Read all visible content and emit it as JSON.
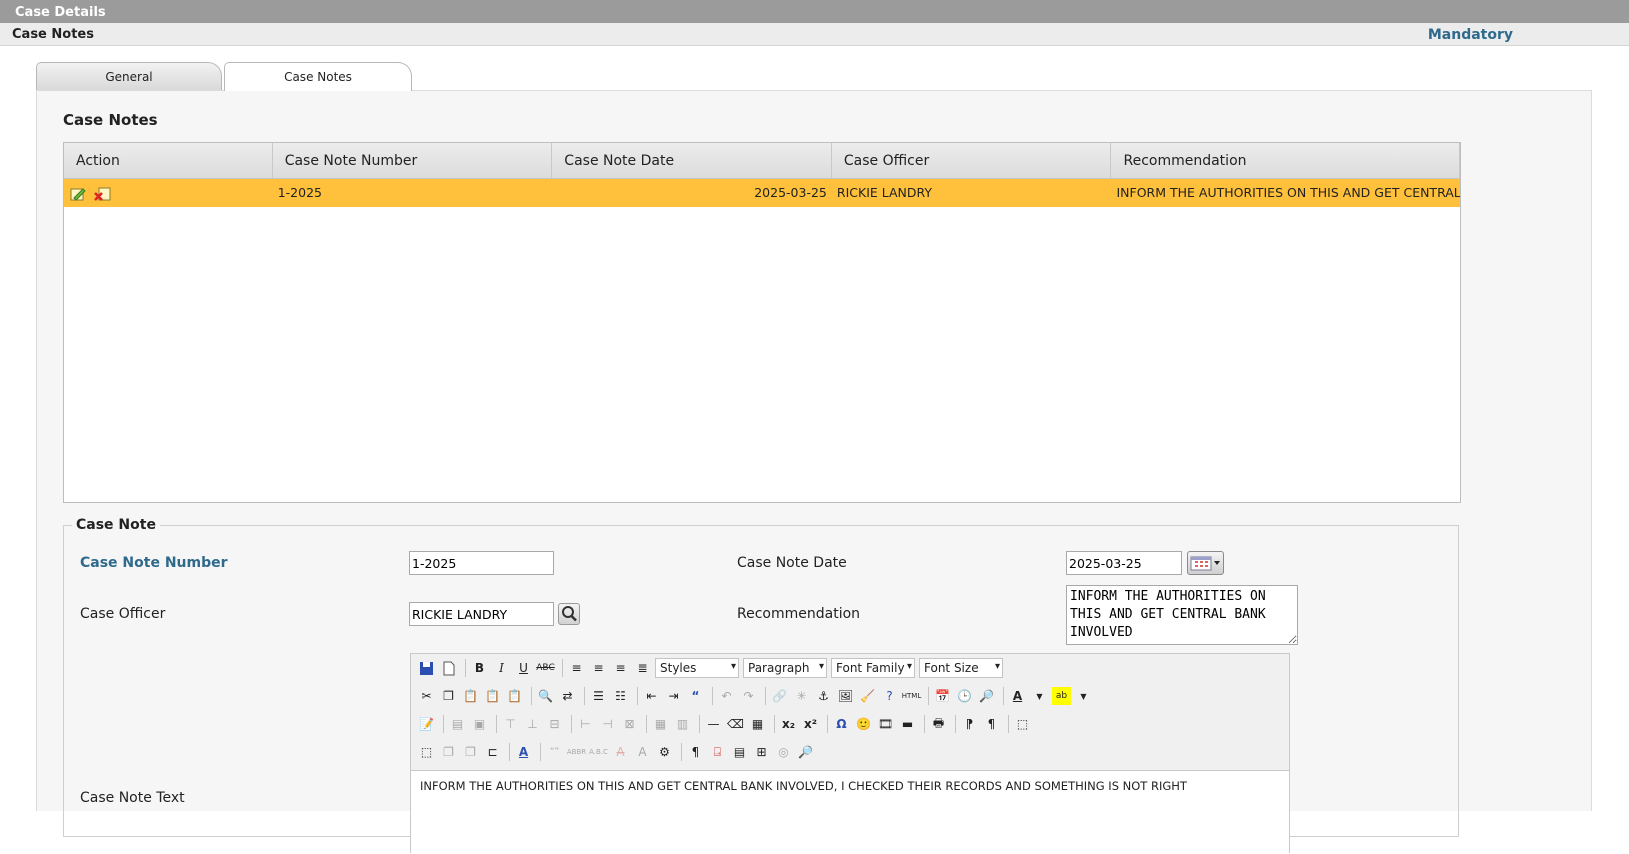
{
  "header": {
    "title": "Case Details",
    "subtitle": "Case Notes",
    "mandatory_label": "Mandatory"
  },
  "tabs": [
    {
      "label": "General",
      "active": false
    },
    {
      "label": "Case Notes",
      "active": true
    }
  ],
  "grid": {
    "title": "Case Notes",
    "columns": [
      "Action",
      "Case Note Number",
      "Case Note Date",
      "Case Officer",
      "Recommendation"
    ],
    "rows": [
      {
        "number": "1-2025",
        "date": "2025-03-25",
        "officer": "RICKIE LANDRY",
        "recommendation": "INFORM THE AUTHORITIES ON THIS AND GET CENTRAL BANK INVOLVED"
      }
    ],
    "selected_row_color": "#ffc13b"
  },
  "form": {
    "legend": "Case Note",
    "number_label": "Case Note Number",
    "number_value": "1-2025",
    "date_label": "Case Note Date",
    "date_value": "2025-03-25",
    "officer_label": "Case Officer",
    "officer_value": "RICKIE LANDRY",
    "recommendation_label": "Recommendation",
    "recommendation_value": "INFORM THE AUTHORITIES ON THIS AND GET CENTRAL BANK INVOLVED",
    "text_label": "Case Note Text",
    "text_value": "INFORM THE AUTHORITIES ON THIS AND GET CENTRAL BANK INVOLVED, I CHECKED THEIR RECORDS AND SOMETHING IS NOT RIGHT"
  },
  "editor": {
    "styles_label": "Styles",
    "format_label": "Paragraph",
    "font_family_label": "Font Family",
    "font_size_label": "Font Size"
  },
  "colors": {
    "accent": "#2f6a8c",
    "titlebar": "#9b9b9b"
  }
}
